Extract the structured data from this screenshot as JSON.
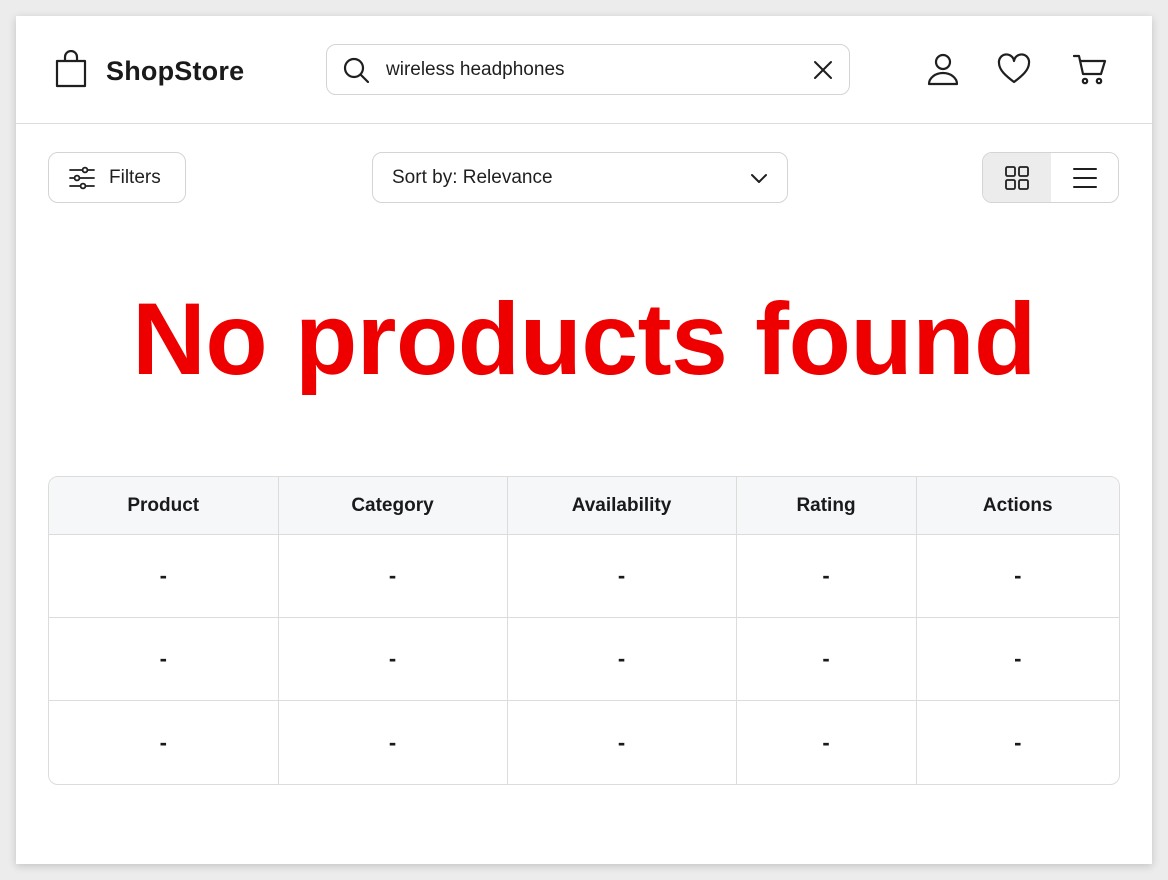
{
  "header": {
    "brand": "ShopStore",
    "search_value": "wireless headphones",
    "icons": [
      "shopping-bag-icon",
      "search-icon",
      "close-icon",
      "user-icon",
      "heart-icon",
      "cart-icon"
    ]
  },
  "toolbar": {
    "filters_label": "Filters",
    "sort_label": "Sort by: Relevance",
    "view_options": [
      "grid-view",
      "list-view"
    ],
    "active_view": "grid-view"
  },
  "empty_state": {
    "message": "No products found",
    "color": "#ee0000"
  },
  "table": {
    "columns": [
      "Product",
      "Category",
      "Availability",
      "Rating",
      "Actions"
    ],
    "rows": [
      [
        "-",
        "-",
        "-",
        "-",
        "-"
      ],
      [
        "-",
        "-",
        "-",
        "-",
        "-"
      ],
      [
        "-",
        "-",
        "-",
        "-",
        "-"
      ]
    ]
  }
}
